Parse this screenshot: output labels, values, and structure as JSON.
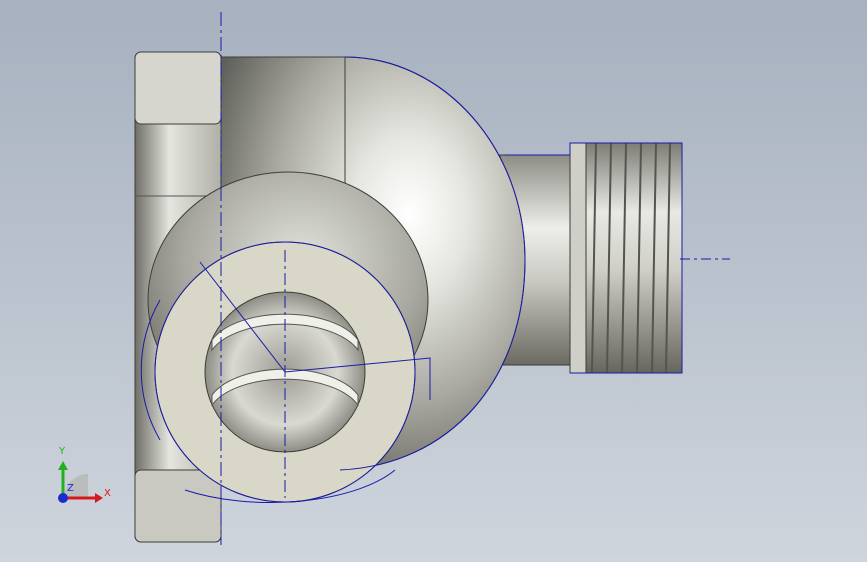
{
  "viewport": {
    "background_top": "#a7b1bf",
    "background_bottom": "#cfd5dd"
  },
  "model": {
    "part": "elbow-fitting-with-threaded-outlet",
    "metal_light": "#f4f4f0",
    "metal_mid": "#b9b9b2",
    "metal_dark": "#5f5f58",
    "face_color": "#d9d8c8",
    "sketch_color": "#1a1aa8"
  },
  "triad": {
    "x_label": "X",
    "y_label": "Y",
    "z_label": "Z",
    "x_color": "#d41a1a",
    "y_color": "#22b022",
    "z_color": "#1a2bd0"
  }
}
